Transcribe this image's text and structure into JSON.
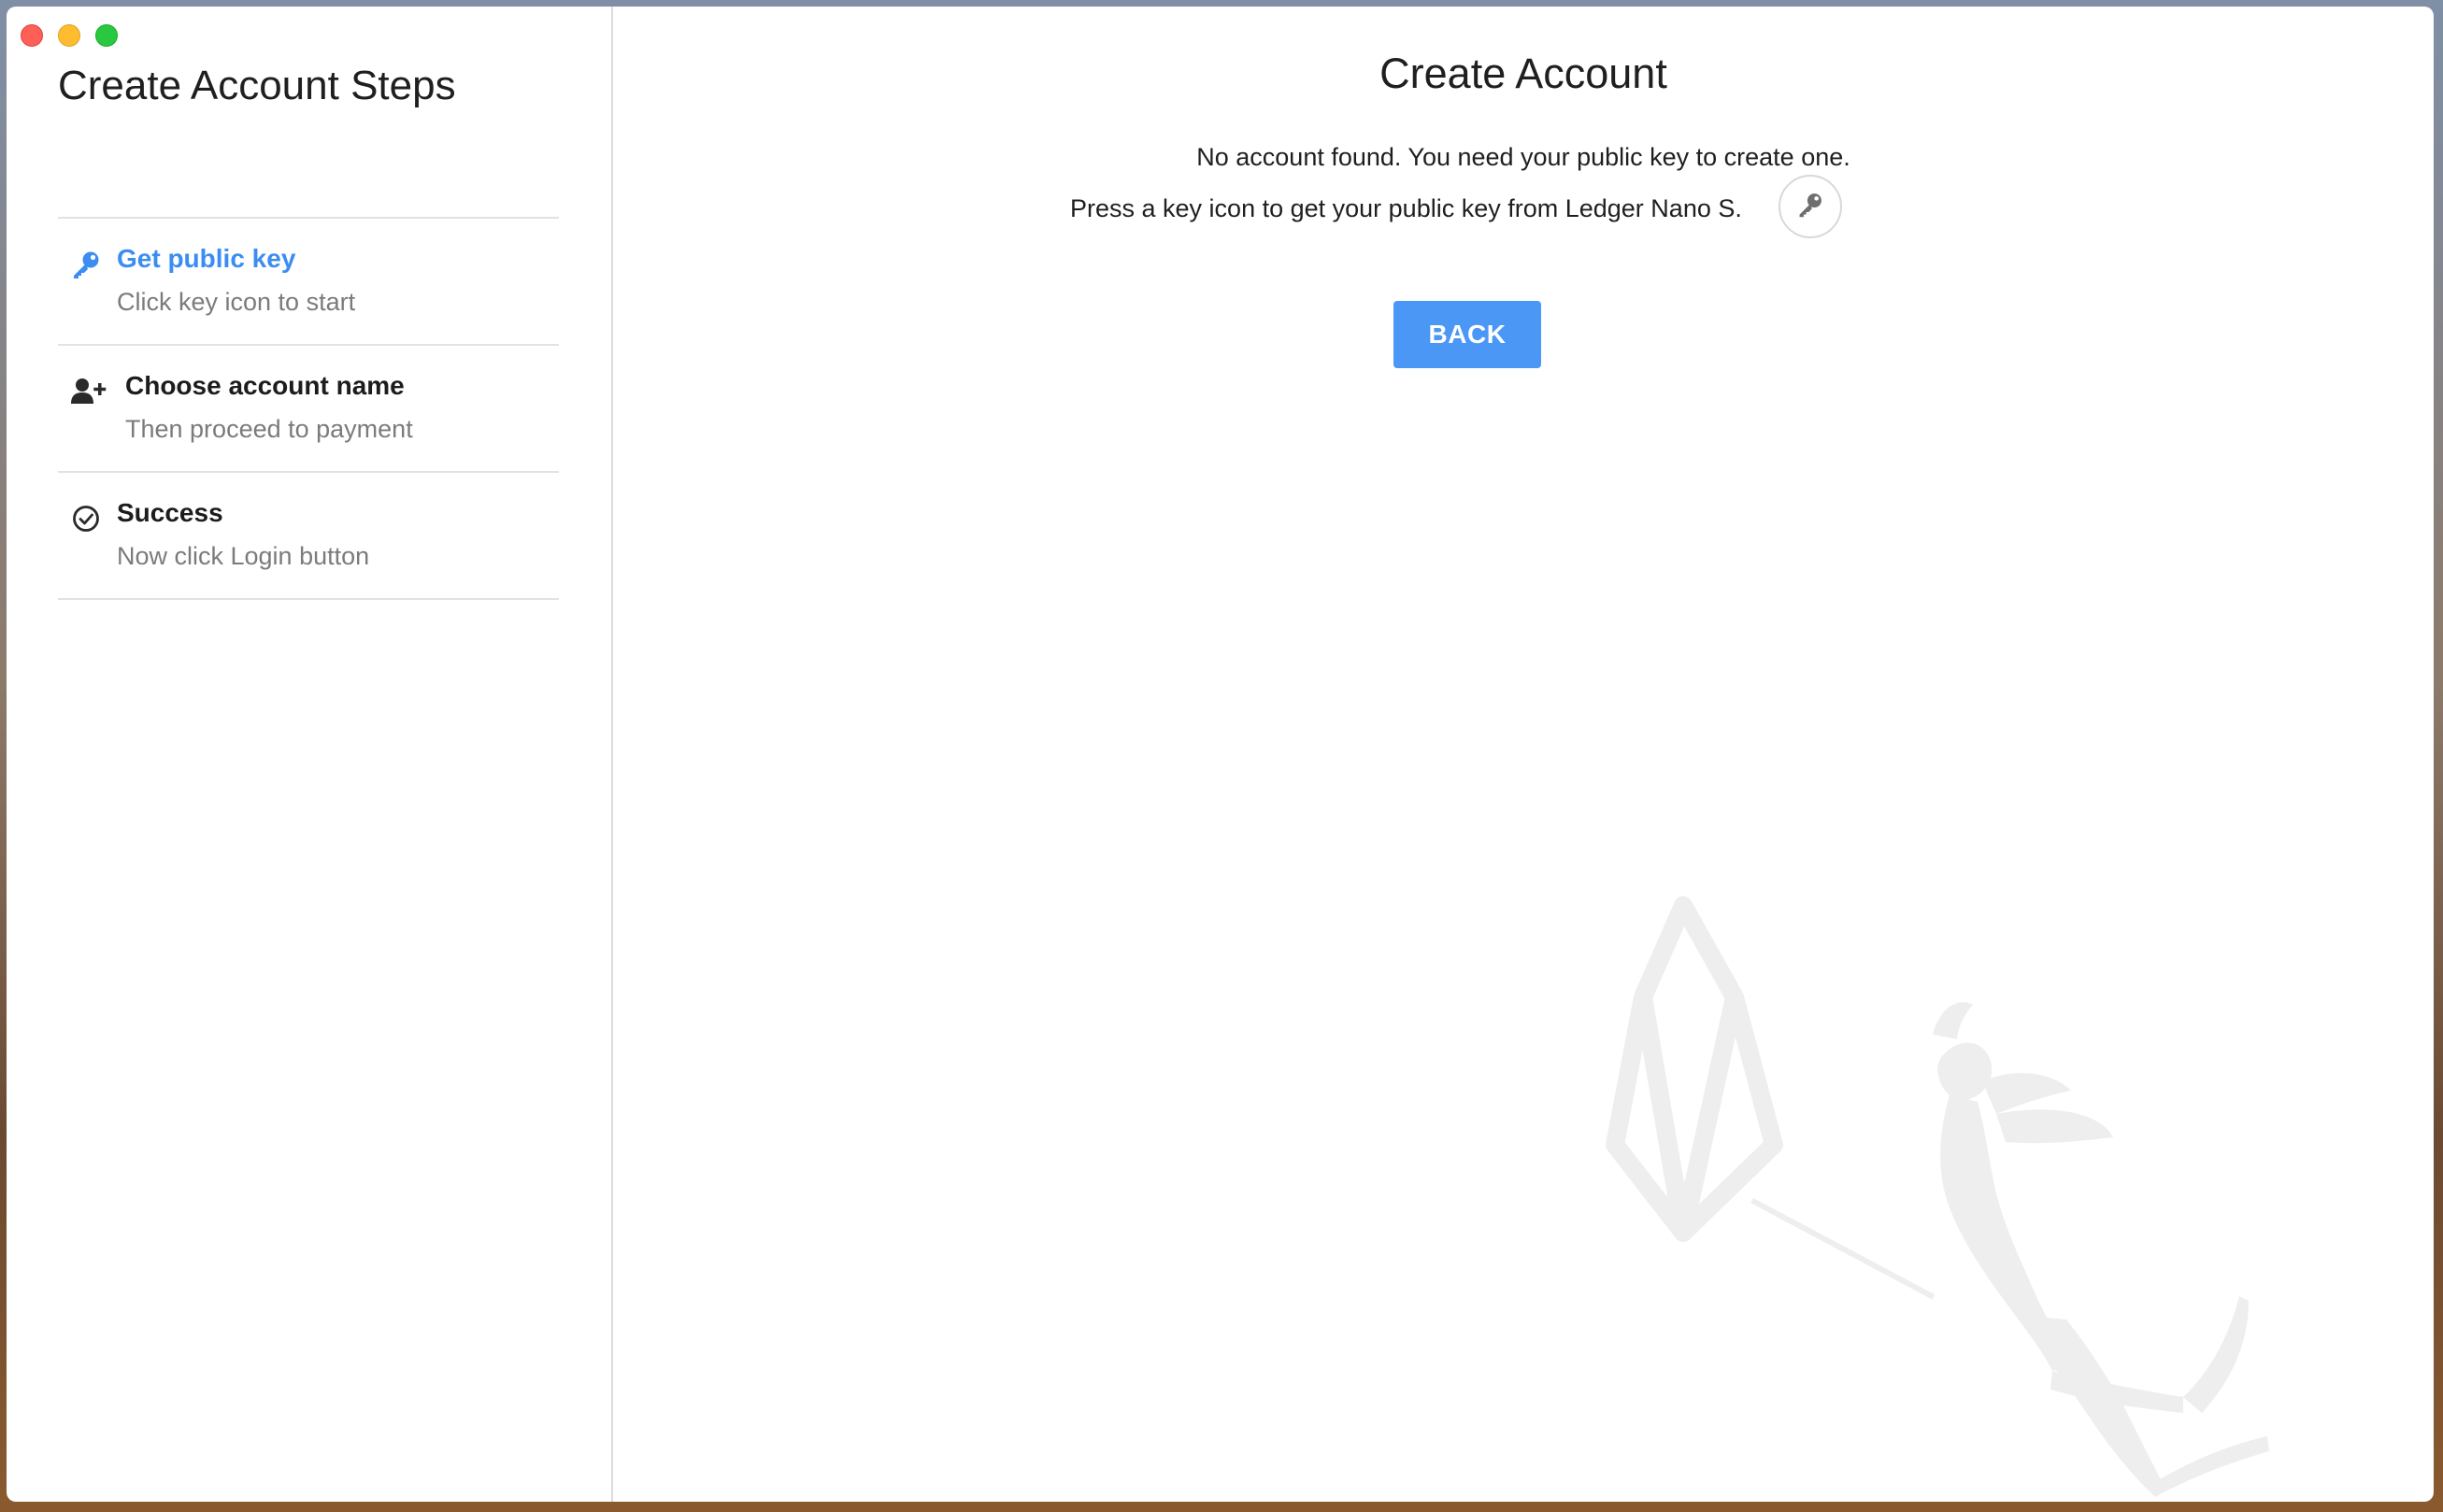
{
  "window": {
    "controls": [
      "close",
      "minimize",
      "zoom"
    ]
  },
  "sidebar": {
    "title": "Create Account Steps",
    "steps": [
      {
        "title": "Get public key",
        "description": "Click key icon to start",
        "icon": "key-icon",
        "active": true
      },
      {
        "title": "Choose account name",
        "description": "Then proceed to payment",
        "icon": "user-plus-icon",
        "active": false
      },
      {
        "title": "Success",
        "description": "Now click Login button",
        "icon": "check-circle-icon",
        "active": false
      }
    ]
  },
  "main": {
    "title": "Create Account",
    "message_line1": "No account found. You need your public key to create one.",
    "message_line2": "Press a key icon to get your public key from Ledger Nano S.",
    "key_button_icon": "key-icon",
    "back_label": "BACK"
  },
  "colors": {
    "accent": "#3b8df2",
    "button": "#4b97f5",
    "muted_text": "#7b7b7b"
  }
}
